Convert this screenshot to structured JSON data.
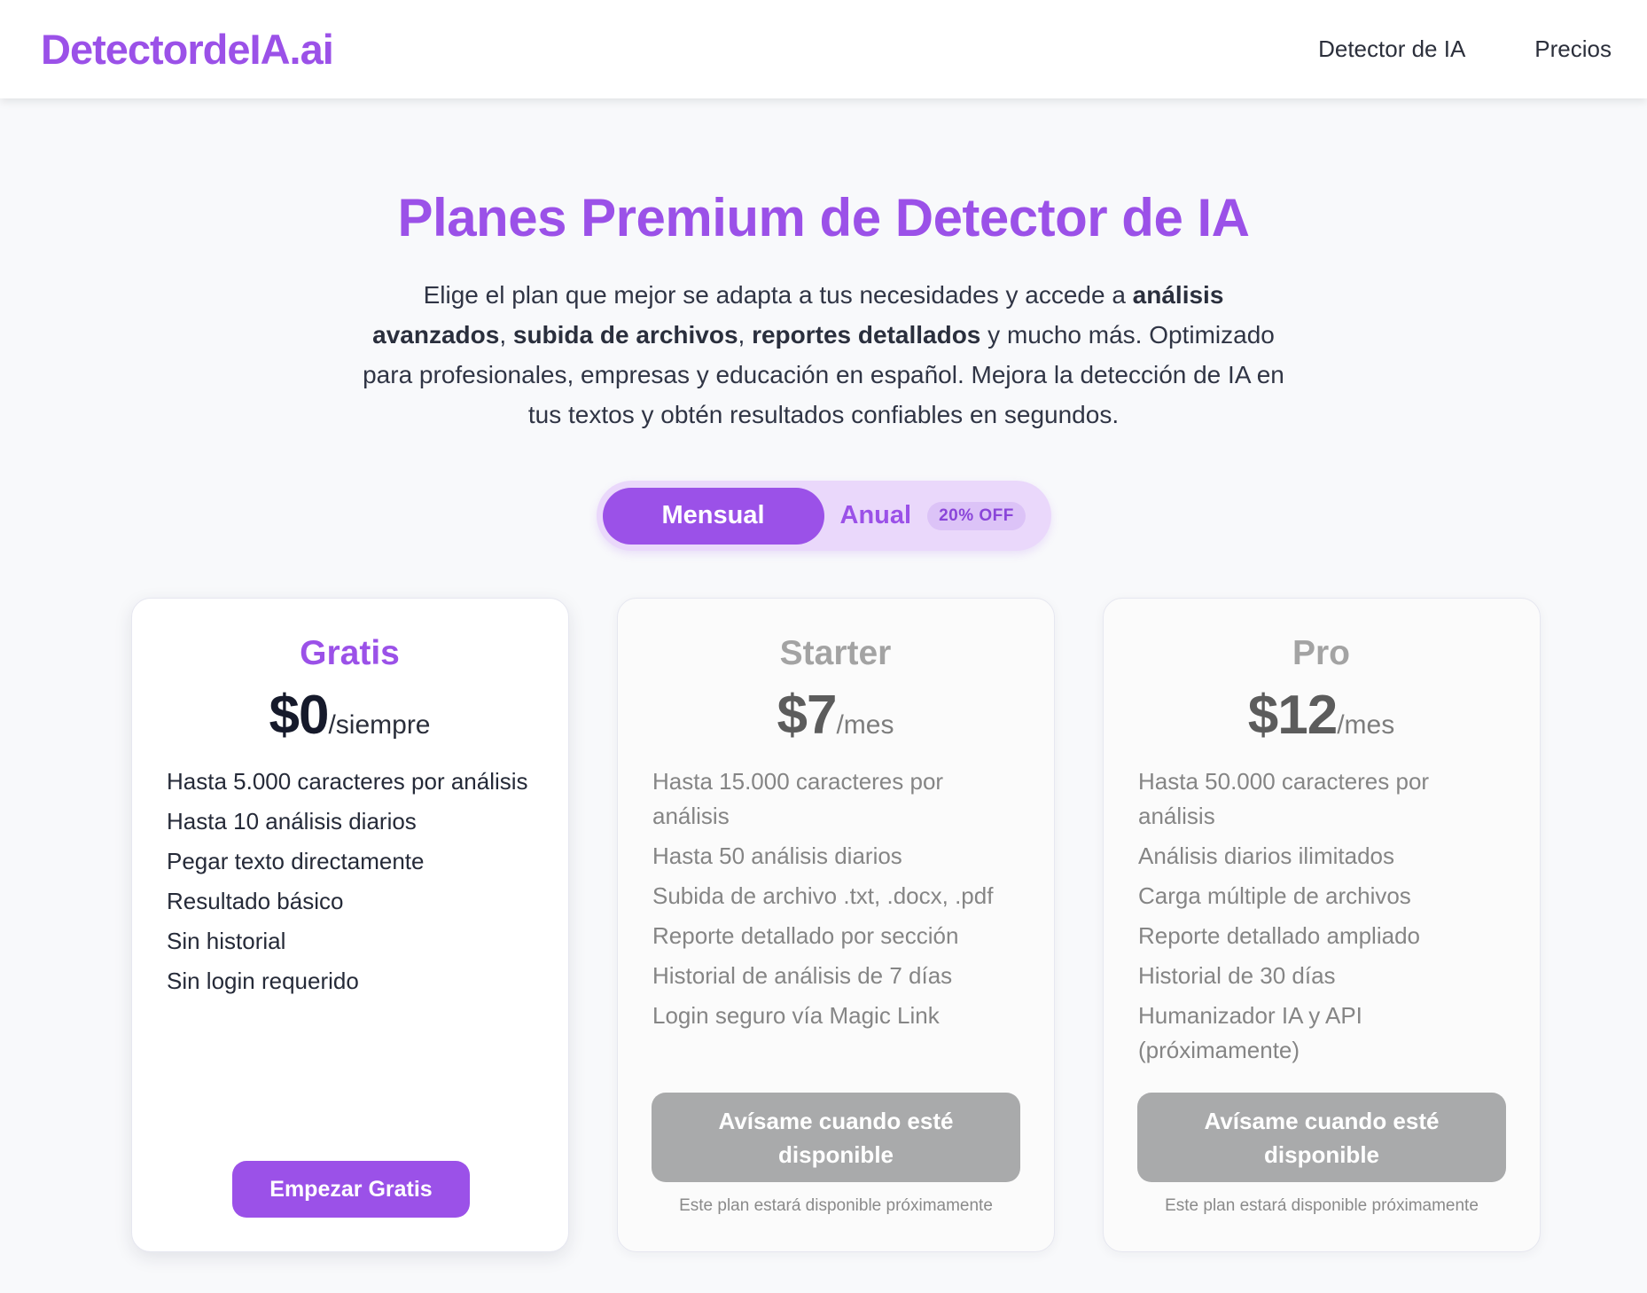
{
  "header": {
    "logo": "DetectordeIA.ai",
    "nav": [
      {
        "label": "Detector de IA"
      },
      {
        "label": "Precios"
      }
    ]
  },
  "hero": {
    "title": "Planes Premium de Detector de IA",
    "desc_1": "Elige el plan que mejor se adapta a tus necesidades y accede a ",
    "desc_b1": "análisis avanzados",
    "desc_2": ", ",
    "desc_b2": "subida de archivos",
    "desc_3": ", ",
    "desc_b3": "reportes detallados",
    "desc_4": " y mucho más. Optimizado para profesionales, empresas y educación en español. Mejora la detección de IA en tus textos y obtén resultados confiables en segundos."
  },
  "billing_toggle": {
    "monthly": "Mensual",
    "annual": "Anual",
    "discount_badge": "20% OFF",
    "selected": "Mensual"
  },
  "plans": [
    {
      "name": "Gratis",
      "price": "$0",
      "period": "/siempre",
      "features": [
        "Hasta 5.000 caracteres por análisis",
        "Hasta 10 análisis diarios",
        "Pegar texto directamente",
        "Resultado básico",
        "Sin historial",
        "Sin login requerido"
      ],
      "button": "Empezar Gratis"
    },
    {
      "name": "Starter",
      "price": "$7",
      "period": "/mes",
      "features": [
        "Hasta 15.000 caracteres por análisis",
        "Hasta 50 análisis diarios",
        "Subida de archivo .txt, .docx, .pdf",
        "Reporte detallado por sección",
        "Historial de análisis de 7 días",
        "Login seguro vía Magic Link"
      ],
      "button": "Avísame cuando esté disponible",
      "note": "Este plan estará disponible próximamente"
    },
    {
      "name": "Pro",
      "price": "$12",
      "period": "/mes",
      "features": [
        "Hasta 50.000 caracteres por análisis",
        "Análisis diarios ilimitados",
        "Carga múltiple de archivos",
        "Reporte detallado ampliado",
        "Historial de 30 días",
        "Humanizador IA y API (próximamente)"
      ],
      "button": "Avísame cuando esté disponible",
      "note": "Este plan estará disponible próximamente"
    }
  ],
  "colors": {
    "brand": "#9b51e8",
    "disabled_button": "#a9aaab",
    "page_bg": "#f8f9fb"
  }
}
